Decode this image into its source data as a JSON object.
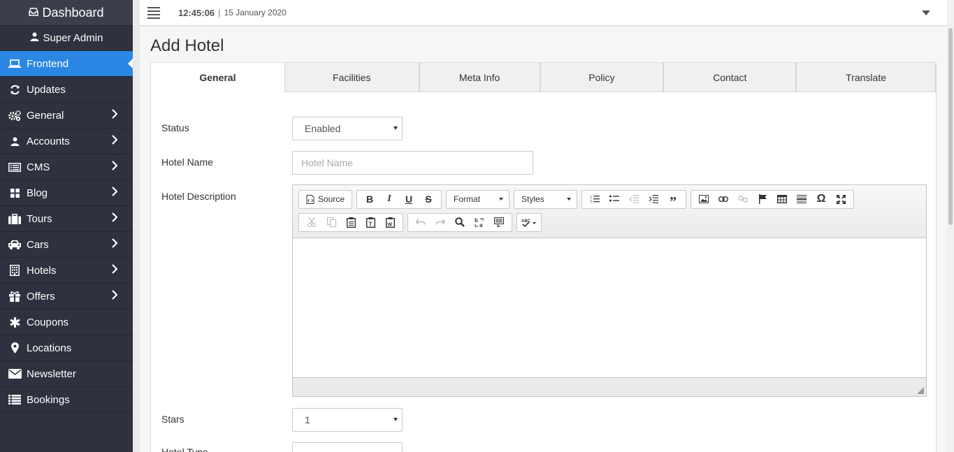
{
  "sidebar": {
    "brand": "Dashboard",
    "user": "Super Admin",
    "items": [
      {
        "label": "Frontend",
        "icon": "laptop-icon",
        "active": true
      },
      {
        "label": "Updates",
        "icon": "refresh-icon"
      },
      {
        "label": "General",
        "icon": "gears-icon",
        "has_arrow": true
      },
      {
        "label": "Accounts",
        "icon": "user-icon",
        "has_arrow": true
      },
      {
        "label": "CMS",
        "icon": "list-icon",
        "has_arrow": true
      },
      {
        "label": "Blog",
        "icon": "grid-icon",
        "has_arrow": true
      },
      {
        "label": "Tours",
        "icon": "suitcase-icon",
        "has_arrow": true
      },
      {
        "label": "Cars",
        "icon": "car-icon",
        "has_arrow": true
      },
      {
        "label": "Hotels",
        "icon": "building-icon",
        "has_arrow": true
      },
      {
        "label": "Offers",
        "icon": "gift-icon",
        "has_arrow": true
      },
      {
        "label": "Coupons",
        "icon": "asterisk-icon"
      },
      {
        "label": "Locations",
        "icon": "map-marker-icon"
      },
      {
        "label": "Newsletter",
        "icon": "envelope-icon"
      },
      {
        "label": "Bookings",
        "icon": "list-icon"
      }
    ]
  },
  "topbar": {
    "time": "12:45:06",
    "separator": "|",
    "date": "15 January 2020"
  },
  "page": {
    "title": "Add Hotel"
  },
  "tabs": [
    {
      "label": "General",
      "active": true
    },
    {
      "label": "Facilities"
    },
    {
      "label": "Meta Info"
    },
    {
      "label": "Policy"
    },
    {
      "label": "Contact"
    },
    {
      "label": "Translate"
    }
  ],
  "form": {
    "status_label": "Status",
    "status_value": "Enabled",
    "hotel_name_label": "Hotel Name",
    "hotel_name_placeholder": "Hotel Name",
    "hotel_name_value": "",
    "description_label": "Hotel Description",
    "stars_label": "Stars",
    "stars_value": "1",
    "hotel_type_label": "Hotel Type"
  },
  "editor": {
    "source_label": "Source",
    "format_label": "Format",
    "styles_label": "Styles"
  }
}
